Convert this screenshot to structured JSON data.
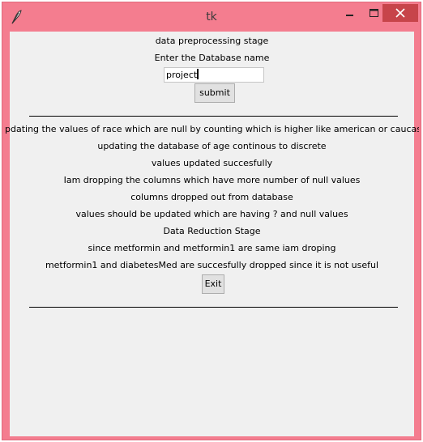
{
  "window": {
    "title": "tk",
    "icon": "feather-icon",
    "controls": [
      "minimize-icon",
      "maximize-icon",
      "close-icon"
    ]
  },
  "form": {
    "stage_label": "data preprocessing stage",
    "prompt_label": "Enter the Database name",
    "db_input_value": "project",
    "submit_label": "submit"
  },
  "messages": [
    "pdating the values of race which are null by counting which is higher like american or caucasia",
    "updating the database of age continous to discrete",
    "values updated succesfully",
    "Iam dropping the columns which have more number of null values",
    "columns dropped out from database",
    "values should be updated which are having ? and null values",
    "Data Reduction Stage",
    "since metformin and metformin1 are same iam droping",
    "metformin1 and diabetesMed are succesfully dropped since it is not useful"
  ],
  "exit_label": "Exit",
  "colors": {
    "titlebar": "#f47d8f",
    "close_button": "#c7444a",
    "client_bg": "#f0f0f0"
  }
}
